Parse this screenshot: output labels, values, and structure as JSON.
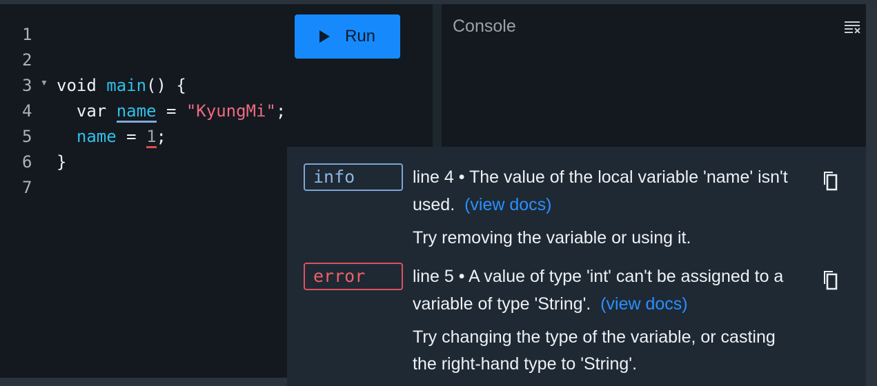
{
  "editor": {
    "line_numbers": [
      "1",
      "2",
      "3",
      "4",
      "5",
      "6",
      "7"
    ],
    "fold_marker": "▼",
    "code": {
      "l3_kw": "void ",
      "l3_fn": "main",
      "l3_rest": "() {",
      "l4_indent": "  ",
      "l4_kw": "var ",
      "l4_var": "name",
      "l4_eq": " = ",
      "l4_str": "\"KyungMi\"",
      "l4_end": ";",
      "l5_indent": "  ",
      "l5_var": "name",
      "l5_eq": " = ",
      "l5_num": "1",
      "l5_end": ";",
      "l6": "}"
    },
    "run_label": "Run"
  },
  "console": {
    "title": "Console",
    "clear_icon": "clear-console-icon"
  },
  "issues": [
    {
      "kind": "info",
      "message": "line 4 • The value of the local variable 'name' isn't used.",
      "link": "(view docs)",
      "fix": "Try removing the variable or using it."
    },
    {
      "kind": "error",
      "message": "line 5 • A value of type 'int' can't be assigned to a variable of type 'String'.",
      "link": "(view docs)",
      "fix": "Try changing the type of the variable, or casting the right-hand type to 'String'."
    }
  ],
  "colors": {
    "background": "#13191f",
    "accent": "#168afd",
    "info": "#7ea5d4",
    "error": "#e0525a",
    "function": "#2fc0e8",
    "string": "#f06a83"
  }
}
